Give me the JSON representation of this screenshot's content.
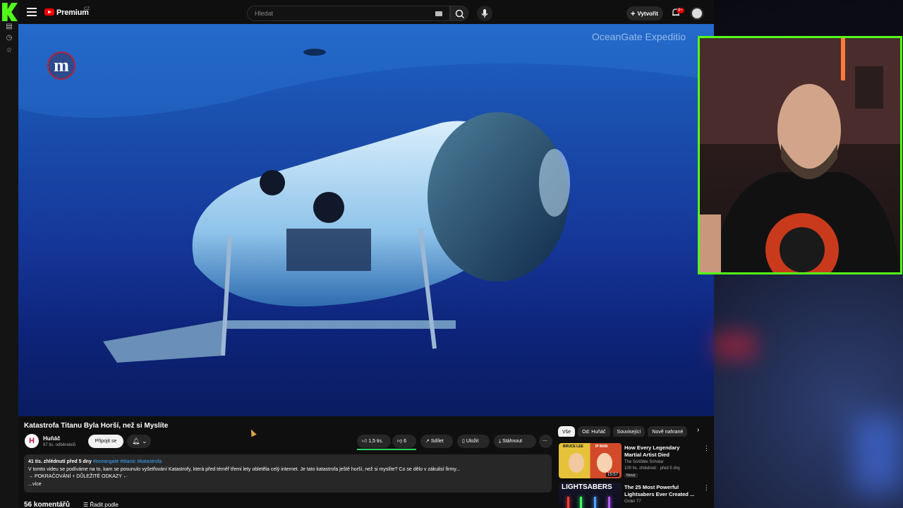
{
  "topbar": {
    "brand": "Premium",
    "brand_region": "CZ",
    "search_placeholder": "Hledat",
    "create_label": "Vytvořit",
    "notif_badge": "9+"
  },
  "video": {
    "watermark": "OceanGate Expeditio",
    "corner_logo": "m",
    "title": "Katastrofa Titanu Byla Horší, než si Myslíte"
  },
  "channel": {
    "avatar_letter": "H",
    "name": "Huňáč",
    "subscribers": "97 tis. odběratelů",
    "join_label": "Připojit se"
  },
  "actions": {
    "likes": "1,5 tis.",
    "dislikes": "6",
    "share": "Sdílet",
    "save": "Uložit",
    "download": "Stáhnout"
  },
  "description": {
    "views_date": "41 tis. zhlédnutí  před 5 dny",
    "tags": "#oceangate #titanic #katastrofa",
    "line1": "V tomto videu se podíváme na to, kam se posunulo vyšetřování Katastrofy, která před téměř třemi lety obletěla celý internet. Je tato katastrofa ještě horší, než si myslíte? Co se dělo v zákulisí firmy...",
    "line2": "→ POKRAČOVÁNÍ + DŮLEŽITÉ ODKAZY ←",
    "more": "...více"
  },
  "comments": {
    "count_label": "56 komentářů",
    "sort_label": "Řadit podle"
  },
  "chips": [
    "Vše",
    "Od: Huňáč",
    "Související",
    "Nově nahrané"
  ],
  "related": [
    {
      "title": "How Every Legendary Martial Artist Died",
      "channel": "The Scribble Scholar",
      "meta": "100 tis. zhlédnutí · před 5 dny",
      "duration": "15:57",
      "badge": "Nový",
      "thumb_text_left": "BRUCE LEE",
      "thumb_text_right": "IP MAN"
    },
    {
      "title": "The 25 Most Powerful Lightsabers Ever Created ...",
      "channel": "Order 77",
      "thumb_text": "LIGHTSABERS"
    }
  ]
}
